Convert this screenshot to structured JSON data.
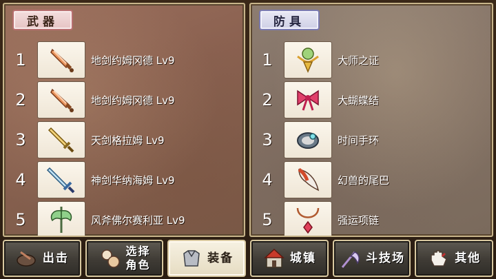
{
  "weapons": {
    "tab_label": "武器",
    "items": [
      {
        "num": "1",
        "name": "地剑约姆冈德 Lv9",
        "icon": "bronze-knife-icon"
      },
      {
        "num": "2",
        "name": "地剑约姆冈德 Lv9",
        "icon": "bronze-knife-icon"
      },
      {
        "num": "3",
        "name": "天剑格拉姆 Lv9",
        "icon": "golden-sword-icon"
      },
      {
        "num": "4",
        "name": "神剑华纳海姆 Lv9",
        "icon": "blue-sword-icon"
      },
      {
        "num": "5",
        "name": "风斧佛尔赛利亚 Lv9",
        "icon": "green-axe-icon"
      }
    ]
  },
  "armor": {
    "tab_label": "防具",
    "items": [
      {
        "num": "1",
        "name": "大师之证",
        "icon": "master-emblem-icon"
      },
      {
        "num": "2",
        "name": "大蝴蝶结",
        "icon": "red-bow-icon"
      },
      {
        "num": "3",
        "name": "时间手环",
        "icon": "bracelet-icon"
      },
      {
        "num": "4",
        "name": "幻兽的尾巴",
        "icon": "beast-tail-icon"
      },
      {
        "num": "5",
        "name": "强运项链",
        "icon": "necklace-icon"
      }
    ]
  },
  "nav": {
    "sortie": "出击",
    "select_character_line1": "选择",
    "select_character_line2": "角色",
    "equipment": "装备",
    "town": "城镇",
    "arena": "斗技场",
    "other": "其他"
  },
  "colors": {
    "weapon_tab_border": "#b76f6f",
    "armor_tab_border": "#7a7ab0",
    "panel_border": "#c8b58a"
  }
}
